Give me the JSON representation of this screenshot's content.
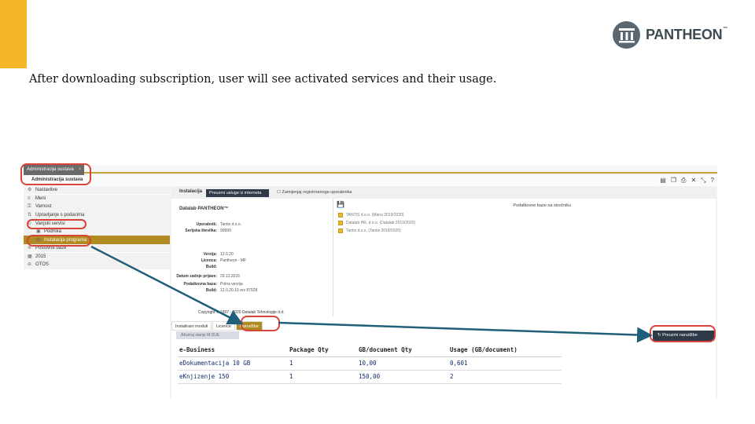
{
  "slide": {
    "caption": "After downloading subscription, user will see activated services and their usage.",
    "accent_color": "#f6b62b"
  },
  "logo": {
    "text": "PANTHEON",
    "mark": "™",
    "icon": "pantheon-column-icon"
  },
  "app": {
    "window_tab": "Administracija sustava",
    "window_close": "×",
    "toolbar_title": "Administracija sustava",
    "toolbar_icons": [
      "document-icon",
      "copy-icon",
      "print-icon",
      "tools-icon",
      "resize-icon",
      "help-icon"
    ],
    "sidebar": [
      {
        "label": "Nastavitve",
        "icon": "gear-icon",
        "sub": false,
        "active": false
      },
      {
        "label": "Meni",
        "icon": "menu-icon",
        "sub": false,
        "active": false
      },
      {
        "label": "Varnost",
        "icon": "lock-icon",
        "sub": false,
        "active": false
      },
      {
        "label": "Upravljanje s podacima",
        "icon": "data-icon",
        "sub": false,
        "active": false
      },
      {
        "label": "Vanjski servisi",
        "icon": "refresh-icon",
        "sub": false,
        "active": false
      },
      {
        "label": "Podrška",
        "icon": "support-icon",
        "sub": true,
        "active": false
      },
      {
        "label": "Instalacija programa",
        "icon": "install-icon",
        "sub": true,
        "active": true
      },
      {
        "label": "Poslovne baze",
        "icon": "database-icon",
        "sub": false,
        "active": false
      },
      {
        "label": "2015",
        "icon": "calendar-icon",
        "sub": false,
        "active": false
      },
      {
        "label": "OTOS",
        "icon": "link-icon",
        "sub": false,
        "active": false
      }
    ],
    "main": {
      "tab_label": "Instalacija",
      "tab_active": "Preuzmi usluge iz interneta",
      "checkbox_label": "Zamijenjaj registriranoga uporabnika",
      "info_title": "Datalab PANTHEON™",
      "info_rows": [
        {
          "k": "Uporabnik:",
          "v": "Tantis d.o.o."
        },
        {
          "k": "Serijska številka:",
          "v": "99999"
        },
        {
          "k": "Verzija:",
          "v": "12.0.20"
        },
        {
          "k": "Licenca:",
          "v": "Pantheon - MF"
        },
        {
          "k": "Build:",
          "v": ""
        },
        {
          "k": "Datum zadnje prijave:",
          "v": "29.12.2016"
        },
        {
          "k": "Podatkovna baza:",
          "v": "Polna verzija"
        },
        {
          "k": "Build:",
          "v": "12.0.20.10 rev 87928"
        }
      ],
      "copyright": "Copyright © 1997 - 2020 Datalab Tehnologije d.d.",
      "db_heading": "Podatkovne baze na strežniku",
      "db_items": [
        "TANTIS d.o.o. (Maria 2019/2020)",
        "Datalab HR, d.o.o. (Datalab 2019/2020)",
        "Tantis d.o.o. (Tantis 2019/2020)"
      ],
      "bottom_tabs": [
        "Instalirani moduli",
        "Licence",
        "Narudžbe"
      ],
      "refresh_button": "Ažuriraj stanje M.DUE",
      "order_button": "Preuzmi narudžbe",
      "table": {
        "headers": [
          "e-Business",
          "Package Qty",
          "GB/document Qty",
          "Usage (GB/document)"
        ],
        "rows": [
          [
            "eDokumentacija 10 GB",
            "1",
            "10,00",
            "0,601"
          ],
          [
            "eKnjizenje 150",
            "1",
            "150,00",
            "2"
          ]
        ]
      }
    }
  },
  "highlight_color": "#d9443a",
  "arrow_color": "#1f5f7a"
}
